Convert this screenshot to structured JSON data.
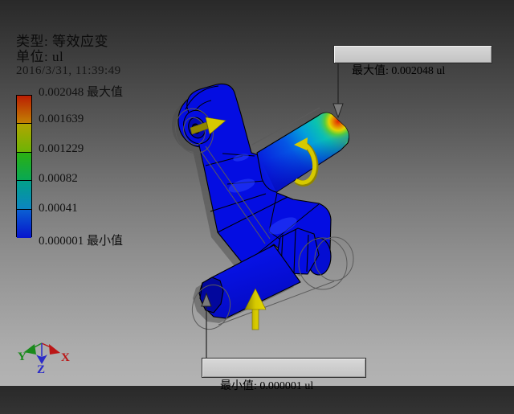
{
  "header": {
    "type_label": "类型: 等效应变",
    "unit_label": "单位: ul",
    "timestamp": "2016/3/31, 11:39:49"
  },
  "legend": {
    "items": [
      {
        "label": "0.002048 最大值"
      },
      {
        "label": "0.001639"
      },
      {
        "label": "0.001229"
      },
      {
        "label": "0.00082"
      },
      {
        "label": "0.00041"
      },
      {
        "label": "0.000001 最小值"
      }
    ],
    "cells": [
      {
        "top": "#bb1e03",
        "bottom": "#c38103"
      },
      {
        "top": "#b2a500",
        "bottom": "#6cb406"
      },
      {
        "top": "#2bb012",
        "bottom": "#09a854"
      },
      {
        "top": "#02a189",
        "bottom": "#0b85c2"
      },
      {
        "top": "#0a5fd2",
        "bottom": "#0714cd"
      }
    ]
  },
  "callouts": {
    "max": "最大值: 0.002048 ul",
    "min": "最小值: 0.000001 ul"
  },
  "triad": {
    "x": "X",
    "y": "Y",
    "z": "Z"
  },
  "colors": {
    "model_blue": "#040de2",
    "model_blue_dark": "#02079d",
    "arrow_yellow": "#d6c900",
    "arrow_yellow_dark": "#8f8500",
    "axis_x_red": "#bb1616",
    "axis_y_green": "#1a8a1c",
    "axis_z_blue": "#2a2ac8"
  }
}
